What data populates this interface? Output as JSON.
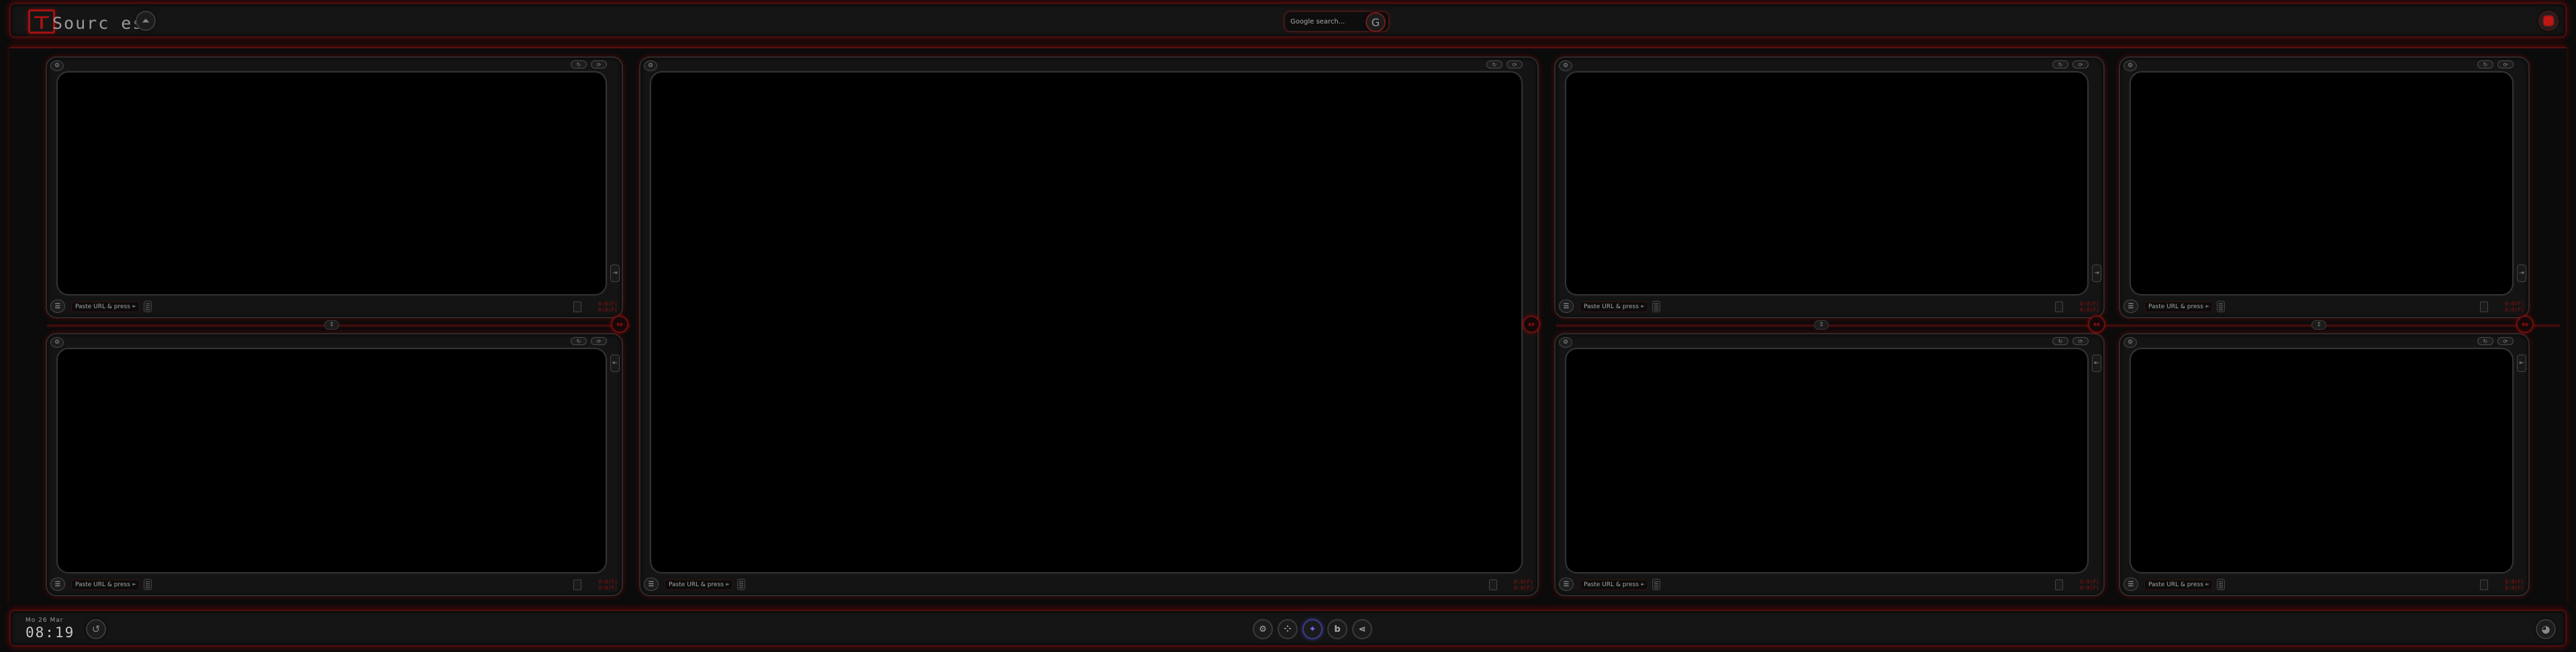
{
  "header": {
    "brand": "Sourc es",
    "search_placeholder": "Google search...",
    "google_glyph": "G",
    "analytics_icon": "chart-icon",
    "close_color": "#c11616"
  },
  "panel_controls": {
    "url_placeholder": "Paste URL & press ↵",
    "menu_glyph": "☰",
    "gear_glyph": "⚙",
    "toggle_left": "↻",
    "toggle_right": "⟳",
    "time_lines": "0:0(F)\n0:0(F)"
  },
  "footer": {
    "date": "Mo  26  Mar",
    "time": "08:19",
    "dock": [
      {
        "icon": "settings-icon",
        "glyph": "⚙"
      },
      {
        "icon": "grid-icon",
        "glyph": "⁘"
      },
      {
        "icon": "sparkle-icon",
        "glyph": "✦"
      },
      {
        "icon": "bing-icon",
        "glyph": "b"
      },
      {
        "icon": "share-icon",
        "glyph": "⋖"
      }
    ],
    "github_glyph": "◕"
  },
  "colors": {
    "accent": "#a11212",
    "active_dock": "#6c6cf2",
    "background": "#0b0b0b"
  }
}
